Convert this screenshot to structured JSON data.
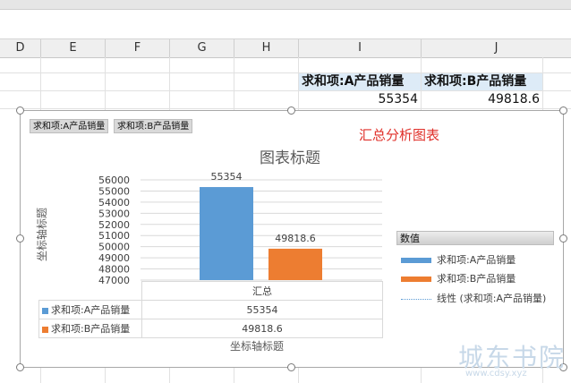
{
  "columns": [
    "D",
    "E",
    "F",
    "G",
    "H",
    "I",
    "J"
  ],
  "sheet": {
    "header_a": "求和项:A产品销量",
    "header_b": "求和项:B产品销量",
    "value_a": "55354",
    "value_b": "49818.6"
  },
  "chart": {
    "field_button_a": "求和项:A产品销量",
    "field_button_b": "求和项:B产品销量",
    "red_title": "汇总分析图表",
    "title": "图表标题",
    "y_axis_title": "坐标轴标题",
    "x_axis_title": "坐标轴标题",
    "legend_title": "数值",
    "legend": [
      "求和项:A产品销量",
      "求和项:B产品销量",
      "线性 (求和项:A产品销量)"
    ],
    "table_rows": [
      {
        "label": "求和项:A产品销量",
        "value": "55354"
      },
      {
        "label": "求和项:B产品销量",
        "value": "49818.6"
      }
    ],
    "colors": {
      "a": "#5b9bd5",
      "b": "#ed7d31"
    }
  },
  "chart_data": {
    "type": "bar",
    "title": "图表标题",
    "xlabel": "坐标轴标题",
    "ylabel": "坐标轴标题",
    "categories": [
      "汇总"
    ],
    "series": [
      {
        "name": "求和项:A产品销量",
        "values": [
          55354
        ]
      },
      {
        "name": "求和项:B产品销量",
        "values": [
          49818.6
        ]
      }
    ],
    "data_labels": [
      "55354",
      "49818.6"
    ],
    "yticks": [
      "47000",
      "48000",
      "49000",
      "50000",
      "51000",
      "52000",
      "53000",
      "54000",
      "55000",
      "56000"
    ],
    "ylim": [
      47000,
      56000
    ],
    "grid": true,
    "legend": "right"
  },
  "watermark": {
    "main": "城东书院",
    "sub": "www.cdsy.xyz"
  }
}
